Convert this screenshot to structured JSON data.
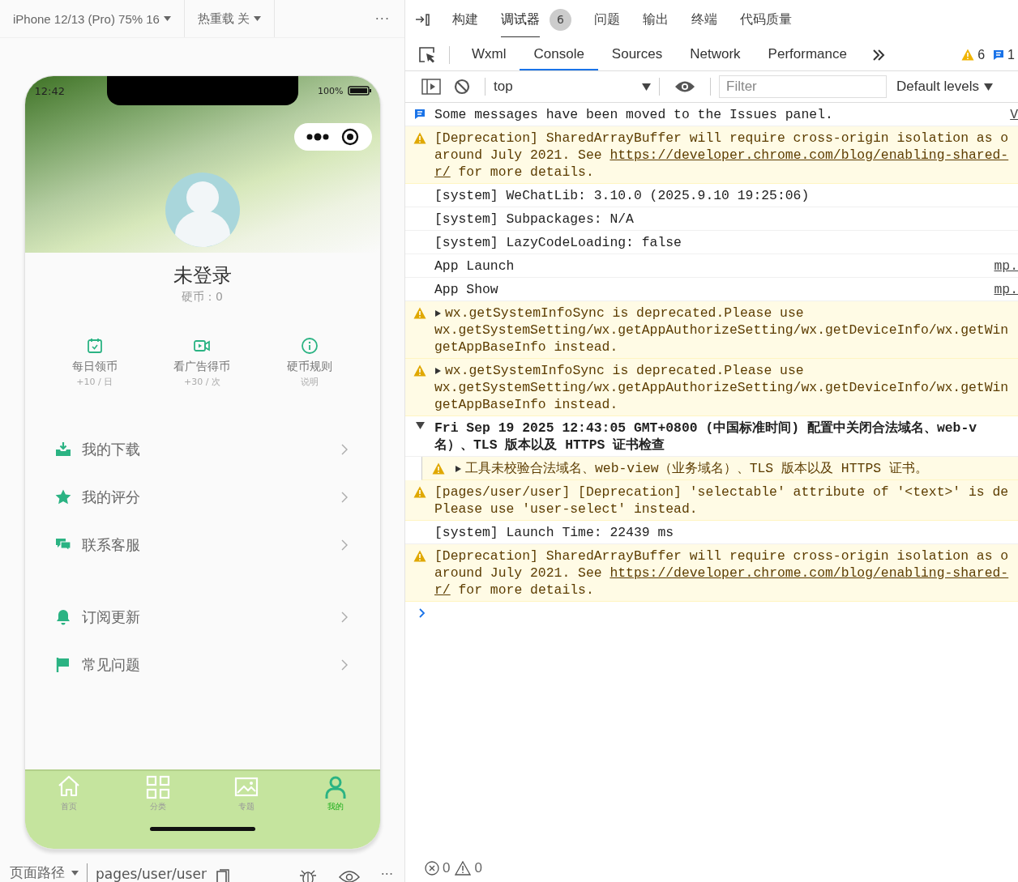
{
  "simulator_toolbar": {
    "device": "iPhone 12/13 (Pro) 75% 16",
    "hot_reload": "热重载 关",
    "more": "···"
  },
  "phone": {
    "status_time": "12:42",
    "battery": "100%",
    "profile": {
      "name": "未登录",
      "coins": "硬币：0"
    },
    "quick_actions": [
      {
        "kind": "calendar",
        "title": "每日领币",
        "subtitle": "+10 / 日"
      },
      {
        "kind": "video",
        "title": "看广告得币",
        "subtitle": "+30 / 次"
      },
      {
        "kind": "info",
        "title": "硬币规则",
        "subtitle": "说明"
      }
    ],
    "menu_groups": [
      [
        {
          "kind": "download",
          "label": "我的下载"
        },
        {
          "kind": "star",
          "label": "我的评分"
        },
        {
          "kind": "chat",
          "label": "联系客服"
        }
      ],
      [
        {
          "kind": "bell",
          "label": "订阅更新"
        },
        {
          "kind": "flag",
          "label": "常见问题"
        }
      ]
    ],
    "tab_bar": [
      {
        "kind": "home",
        "label": "首页",
        "selected": false
      },
      {
        "kind": "grid",
        "label": "分类",
        "selected": false
      },
      {
        "kind": "image",
        "label": "专题",
        "selected": false
      },
      {
        "kind": "person",
        "label": "我的",
        "selected": true
      }
    ]
  },
  "page_path": {
    "label": "页面路径",
    "path": "pages/user/user",
    "more": "···"
  },
  "devtools": {
    "panels": [
      {
        "label": "构建",
        "selected": false
      },
      {
        "label": "调试器",
        "selected": true,
        "badge": "6"
      },
      {
        "label": "问题",
        "selected": false
      },
      {
        "label": "输出",
        "selected": false
      },
      {
        "label": "终端",
        "selected": false
      },
      {
        "label": "代码质量",
        "selected": false
      }
    ],
    "tabs": [
      {
        "label": "Wxml",
        "selected": false
      },
      {
        "label": "Console",
        "selected": true
      },
      {
        "label": "Sources",
        "selected": false
      },
      {
        "label": "Network",
        "selected": false
      },
      {
        "label": "Performance",
        "selected": false
      }
    ],
    "warning_count": "6",
    "info_count": "1",
    "console_toolbar": {
      "context": "top",
      "filter_placeholder": "Filter",
      "levels": "Default levels"
    },
    "messages": [
      {
        "kind": "info",
        "lines": [
          {
            "text": "Some messages have been moved to the Issues panel."
          }
        ],
        "source": "V"
      },
      {
        "kind": "warning",
        "lines": [
          {
            "text": "[Deprecation] SharedArrayBuffer will require cross-origin isolation as o"
          },
          {
            "text": "around July 2021. See ",
            "link": "https://developer.chrome.com/blog/enabling-shared-"
          },
          {
            "link": "r/",
            "after": " for more details."
          }
        ]
      },
      {
        "kind": "log",
        "lines": [
          {
            "text": "[system] WeChatLib: 3.10.0 (2025.9.10 19:25:06)"
          }
        ]
      },
      {
        "kind": "log",
        "lines": [
          {
            "text": "[system] Subpackages: N/A"
          }
        ]
      },
      {
        "kind": "log",
        "lines": [
          {
            "text": "[system] LazyCodeLoading: false"
          }
        ]
      },
      {
        "kind": "log",
        "lines": [
          {
            "text": "App Launch"
          }
        ],
        "source": "mp."
      },
      {
        "kind": "log",
        "lines": [
          {
            "text": "App Show"
          }
        ],
        "source": "mp."
      },
      {
        "kind": "warning",
        "expanded": false,
        "lines": [
          {
            "text": "wx.getSystemInfoSync is deprecated.Please use"
          },
          {
            "text": "wx.getSystemSetting/wx.getAppAuthorizeSetting/wx.getDeviceInfo/wx.getWin"
          },
          {
            "text": "getAppBaseInfo instead."
          }
        ]
      },
      {
        "kind": "warning",
        "expanded": false,
        "lines": [
          {
            "text": "wx.getSystemInfoSync is deprecated.Please use"
          },
          {
            "text": "wx.getSystemSetting/wx.getAppAuthorizeSetting/wx.getDeviceInfo/wx.getWin"
          },
          {
            "text": "getAppBaseInfo instead."
          }
        ]
      },
      {
        "kind": "group",
        "expanded": true,
        "lines": [
          {
            "text": "Fri Sep 19 2025 12:43:05 GMT+0800 (中国标准时间) 配置中关闭合法域名、web-v"
          },
          {
            "text": "名）、TLS 版本以及 HTTPS 证书检查"
          }
        ]
      },
      {
        "kind": "nested-warning",
        "expanded": false,
        "lines": [
          {
            "text": "工具未校验合法域名、web-view（业务域名）、TLS 版本以及 HTTPS 证书。"
          }
        ]
      },
      {
        "kind": "warning",
        "lines": [
          {
            "text": "[pages/user/user] [Deprecation] 'selectable' attribute of '<text>' is de"
          },
          {
            "text": "Please use 'user-select' instead."
          }
        ]
      },
      {
        "kind": "log",
        "lines": [
          {
            "text": "[system] Launch Time: 22439 ms"
          }
        ]
      },
      {
        "kind": "warning",
        "lines": [
          {
            "text": "[Deprecation] SharedArrayBuffer will require cross-origin isolation as o"
          },
          {
            "text": "around July 2021. See ",
            "link": "https://developer.chrome.com/blog/enabling-shared-"
          },
          {
            "link": "r/",
            "after": " for more details."
          }
        ]
      }
    ],
    "footer": {
      "errors": "0",
      "warnings": "0"
    }
  }
}
